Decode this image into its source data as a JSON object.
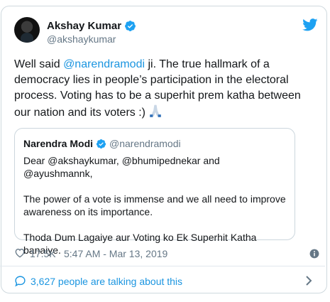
{
  "author": {
    "name": "Akshay Kumar",
    "handle": "@akshaykumar"
  },
  "tweet": {
    "text_1": "Well said ",
    "mention": "@narendramodi",
    "text_2": " ji. The true hallmark of a democracy lies in people’s participation in the electoral process. Voting has to be a superhit prem katha between our nation and its voters :) "
  },
  "quoted": {
    "name": "Narendra Modi",
    "handle": "@narendramodi",
    "text": "Dear @akshaykumar, @bhumipednekar and @ayushmannk,\n\nThe power of a vote is immense and we all need to improve awareness on its importance.\n\nThoda Dum Lagaiye aur Voting ko Ek Superhit Katha banaiye."
  },
  "meta": {
    "likes": "17.5K",
    "timestamp": "5:47 AM - Mar 13, 2019"
  },
  "conversation": {
    "label": "3,627 people are talking about this"
  },
  "colors": {
    "accent": "#1b95e0",
    "muted": "#657786",
    "text": "#14171a",
    "border": "#cfd9de"
  },
  "icons": [
    "verified-badge-icon",
    "twitter-bird-icon",
    "praying-hands-emoji",
    "heart-icon",
    "info-icon",
    "speech-bubble-icon",
    "chevron-right-icon"
  ]
}
